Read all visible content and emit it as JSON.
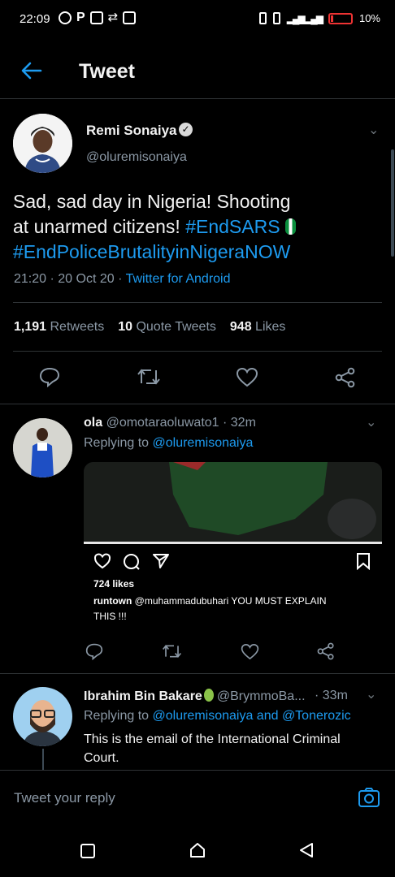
{
  "status_bar": {
    "time": "22:09",
    "battery": "10%"
  },
  "header": {
    "title": "Tweet"
  },
  "main_tweet": {
    "name": "Remi Sonaiya",
    "handle": "@oluremisonaiya",
    "text_line1": "Sad, sad day in Nigeria! Shooting",
    "text_line2_plain": "at unarmed citizens! ",
    "hashtag1": "#EndSARS",
    "hashtag2": "#EndPoliceBrutalityinNigeraNOW",
    "time": "21:20 · 20 Oct 20 · ",
    "source": "Twitter for Android",
    "retweets_count": "1,191",
    "retweets_label": "Retweets",
    "quotes_count": "10",
    "quotes_label": "Quote Tweets",
    "likes_count": "948",
    "likes_label": "Likes"
  },
  "reply1": {
    "name": "ola",
    "handle_time": "@omotaraoluwato1 · 32m",
    "replying_prefix": "Replying to ",
    "replying_to": "@oluremisonaiya",
    "ig_likes": "724 likes",
    "ig_caption_user": "runtown",
    "ig_caption_line1": " @muhammadubuhari  YOU MUST EXPLAIN",
    "ig_caption_line2": "THIS !!!"
  },
  "reply2": {
    "name": "Ibrahim Bin Bakare",
    "handle": "@BrymmoBa...",
    "time": " · 33m",
    "replying_prefix": "Replying to ",
    "replying_to": "@oluremisonaiya and @Tonerozic",
    "text_line1": "This is the email of the International Criminal",
    "text_line2": "Court."
  },
  "reply_bar": {
    "placeholder": "Tweet your reply"
  },
  "colors": {
    "accent": "#1d9bf0",
    "background": "#000000",
    "divider": "#2f3336"
  }
}
